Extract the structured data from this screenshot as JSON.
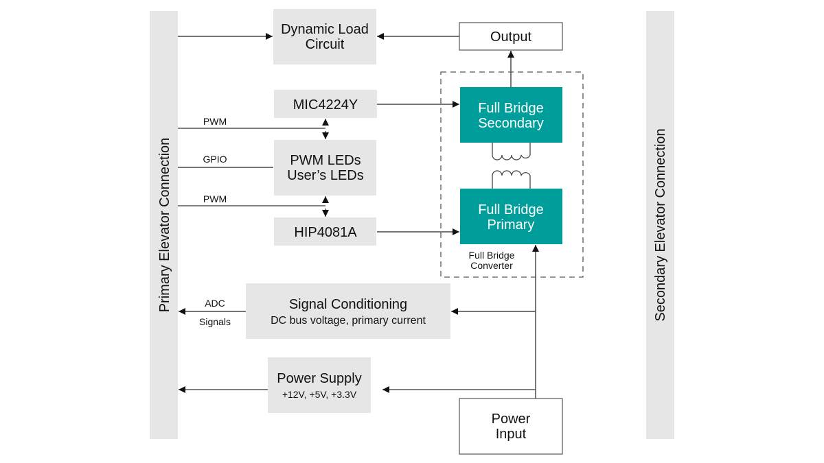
{
  "diagram": {
    "rails": {
      "primary": "Primary Elevator Connection",
      "secondary": "Secondary Elevator Connection"
    },
    "blocks": {
      "dynamic_load": [
        "Dynamic Load",
        "Circuit"
      ],
      "output": "Output",
      "mic": "MIC4224Y",
      "leds": [
        "PWM LEDs",
        "User’s LEDs"
      ],
      "hip": "HIP4081A",
      "fb_secondary": [
        "Full Bridge",
        "Secondary"
      ],
      "fb_primary": [
        "Full Bridge",
        "Primary"
      ],
      "fb_converter": [
        "Full Bridge",
        "Converter"
      ],
      "signal_cond": [
        "Signal Conditioning",
        "DC bus voltage, primary current"
      ],
      "power_supply": [
        "Power Supply",
        "+12V, +5V, +3.3V"
      ],
      "power_input": [
        "Power",
        "Input"
      ]
    },
    "signals": {
      "pwm_top": "PWM",
      "gpio": "GPIO",
      "pwm_bottom": "PWM",
      "adc": "ADC",
      "adc_signals": "Signals"
    },
    "colors": {
      "block_fill": "#e6e6e6",
      "accent": "#009e9a"
    }
  }
}
